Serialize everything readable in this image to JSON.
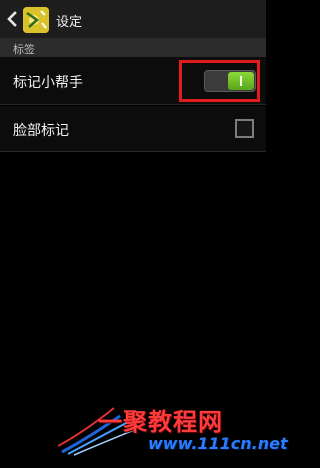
{
  "header": {
    "title": "设定",
    "back_icon": "back-arrow-icon",
    "app_icon": "tag-app-icon"
  },
  "section": {
    "label": "标签"
  },
  "settings": [
    {
      "label": "标记小帮手",
      "control": "toggle",
      "state": "on"
    },
    {
      "label": "脸部标记",
      "control": "checkbox",
      "state": "unchecked"
    }
  ],
  "watermark": {
    "title": "一聚教程网",
    "url": "www.111cn.net"
  },
  "colors": {
    "background": "#000000",
    "action_bar": "#1d1d1d",
    "section_header": "#2c2c2c",
    "toggle_on": "#6fc22a",
    "highlight": "#e21b1b"
  }
}
